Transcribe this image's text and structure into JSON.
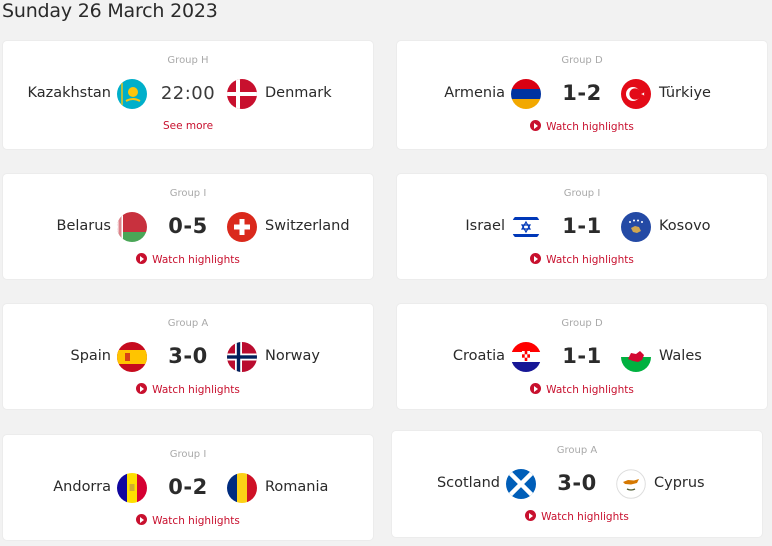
{
  "date_heading": "Sunday 26 March 2023",
  "colors": {
    "accent": "#c8102e",
    "card_bg": "#ffffff",
    "page_bg": "#f2f2f2"
  },
  "matches": [
    {
      "group": "Group H",
      "home": "Kazakhstan",
      "away": "Denmark",
      "score": "22:00",
      "link": "See more",
      "home_flag": "kazakhstan-flag-icon",
      "away_flag": "denmark-flag-icon"
    },
    {
      "group": "Group D",
      "home": "Armenia",
      "away": "Türkiye",
      "score": "1-2",
      "link": "Watch highlights",
      "home_flag": "armenia-flag-icon",
      "away_flag": "turkiye-flag-icon"
    },
    {
      "group": "Group I",
      "home": "Belarus",
      "away": "Switzerland",
      "score": "0-5",
      "link": "Watch highlights",
      "home_flag": "belarus-flag-icon",
      "away_flag": "switzerland-flag-icon"
    },
    {
      "group": "Group I",
      "home": "Israel",
      "away": "Kosovo",
      "score": "1-1",
      "link": "Watch highlights",
      "home_flag": "israel-flag-icon",
      "away_flag": "kosovo-flag-icon"
    },
    {
      "group": "Group A",
      "home": "Spain",
      "away": "Norway",
      "score": "3-0",
      "link": "Watch highlights",
      "home_flag": "spain-flag-icon",
      "away_flag": "norway-flag-icon"
    },
    {
      "group": "Group D",
      "home": "Croatia",
      "away": "Wales",
      "score": "1-1",
      "link": "Watch highlights",
      "home_flag": "croatia-flag-icon",
      "away_flag": "wales-flag-icon"
    },
    {
      "group": "Group I",
      "home": "Andorra",
      "away": "Romania",
      "score": "0-2",
      "link": "Watch highlights",
      "home_flag": "andorra-flag-icon",
      "away_flag": "romania-flag-icon"
    },
    {
      "group": "Group A",
      "home": "Scotland",
      "away": "Cyprus",
      "score": "3-0",
      "link": "Watch highlights",
      "home_flag": "scotland-flag-icon",
      "away_flag": "cyprus-flag-icon"
    }
  ]
}
